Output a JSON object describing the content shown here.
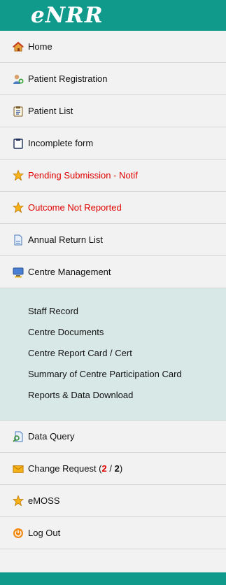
{
  "brand": {
    "logo_text": "eNRR"
  },
  "menu": [
    {
      "key": "home",
      "label": "Home",
      "icon": "home-icon"
    },
    {
      "key": "patient-registration",
      "label": "Patient Registration",
      "icon": "add-user-icon"
    },
    {
      "key": "patient-list",
      "label": "Patient List",
      "icon": "clipboard-list-icon"
    },
    {
      "key": "incomplete-form",
      "label": "Incomplete form",
      "icon": "clipboard-icon"
    },
    {
      "key": "pending-submission",
      "label": "Pending Submission - Notif",
      "icon": "star-icon",
      "alert": true
    },
    {
      "key": "outcome-not-reported",
      "label": "Outcome Not Reported",
      "icon": "star-icon",
      "alert": true
    },
    {
      "key": "annual-return-list",
      "label": "Annual Return List",
      "icon": "document-icon"
    },
    {
      "key": "centre-management",
      "label": "Centre Management",
      "icon": "monitor-icon"
    }
  ],
  "centre_submenu": [
    "Staff Record",
    "Centre Documents",
    "Centre Report Card / Cert",
    "Summary of Centre Participation Card",
    "Reports & Data Download"
  ],
  "lower_menu": {
    "data_query": "Data Query",
    "change_request": {
      "label": "Change Request (",
      "count": "2",
      "sep": " / ",
      "total": "2",
      "end": ")"
    },
    "emoss": "eMOSS",
    "logout": "Log Out"
  },
  "colors": {
    "header_bg": "#0f9a8c",
    "menu_bg": "#f2f2f2",
    "submenu_bg": "#d8e8e6",
    "alert_text": "#e00000"
  }
}
